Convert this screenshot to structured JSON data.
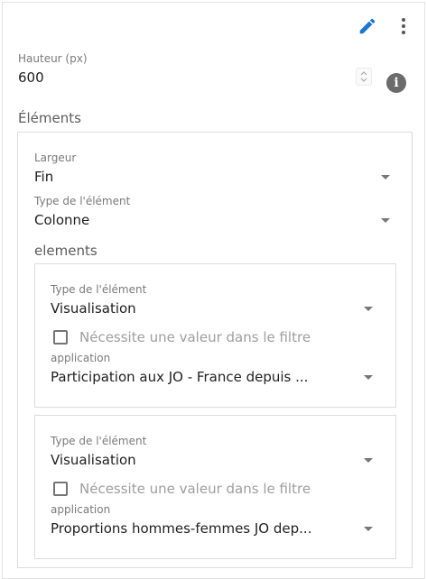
{
  "header": {
    "edit_icon": "pencil-icon",
    "menu_icon": "more-vertical-icon"
  },
  "height_field": {
    "label": "Hauteur (px)",
    "value": "600",
    "info_icon": "info-icon"
  },
  "elements_section": {
    "title": "Éléments",
    "width_label": "Largeur",
    "width_value": "Fin",
    "type_label": "Type de l'élément",
    "type_value": "Colonne",
    "elements_title": "elements",
    "items": [
      {
        "type_label": "Type de l'élément",
        "type_value": "Visualisation",
        "checkbox_label": "Nécessite une valeur dans le filtre",
        "app_label": "application",
        "app_value": "Participation aux JO - France depuis ..."
      },
      {
        "type_label": "Type de l'élément",
        "type_value": "Visualisation",
        "checkbox_label": "Nécessite une valeur dans le filtre",
        "app_label": "application",
        "app_value": "Proportions hommes-femmes JO dep..."
      }
    ]
  },
  "colors": {
    "accent": "#1976d2",
    "border": "#dcdcdc",
    "caption": "#7a7a7a"
  }
}
